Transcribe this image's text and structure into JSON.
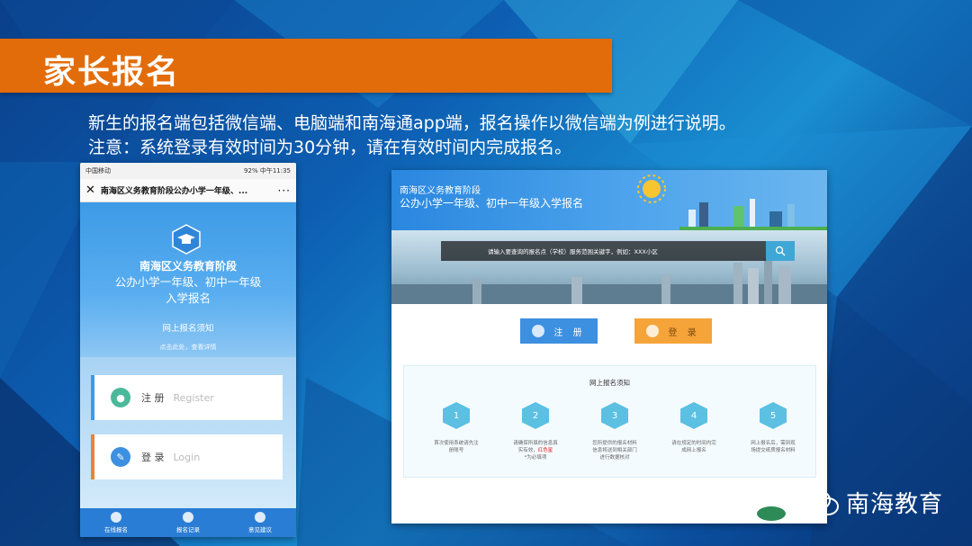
{
  "slide": {
    "title": "家长报名",
    "intro_line1": "新生的报名端包括微信端、电脑端和南海通app端，报名操作以微信端为例进行说明。",
    "intro_line2": "注意：系统登录有效时间为30分钟，请在有效时间内完成报名。",
    "watermark": "南海教育",
    "colors": {
      "banner": "#e36c0a",
      "background": "#0d5fb3"
    }
  },
  "phone": {
    "status_left": "中国移动",
    "status_right": "92% 中午11:35",
    "nav_title": "南海区义务教育阶段公办小学一年级、...",
    "nav_close": "✕",
    "nav_more": "···",
    "hero_line1": "南海区义务教育阶段",
    "hero_line2": "公办小学一年级、初中一年级",
    "hero_line3": "入学报名",
    "notice_link": "网上报名须知",
    "notice_sub": "点击此处，查看详情",
    "register_cn": "注 册",
    "register_en": "Register",
    "login_cn": "登 录",
    "login_en": "Login",
    "tabs": [
      "在线报名",
      "报名记录",
      "意见建议"
    ]
  },
  "web": {
    "header_line1": "南海区义务教育阶段",
    "header_line2": "公办小学一年级、初中一年级入学报名",
    "search_placeholder": "请输入要查询的报名点（学校）服务范围关键字，例如：XXX小区",
    "register_button": "注 册",
    "login_button": "登 录",
    "notice_title": "网上报名须知",
    "steps": [
      {
        "num": "1",
        "text_a": "首次使用系统请先注",
        "text_b": "册账号",
        "text_red": "",
        "text_c": ""
      },
      {
        "num": "2",
        "text_a": "请确保所填的信息真",
        "text_b": "实有效，",
        "text_red": "红色星",
        "text_c": "*为必填项"
      },
      {
        "num": "3",
        "text_a": "您所提供的报名材料",
        "text_b": "信息将送到相关部门",
        "text_red": "",
        "text_c": "进行数据核对"
      },
      {
        "num": "4",
        "text_a": "请在规定的时间内完",
        "text_b": "成网上报名",
        "text_red": "",
        "text_c": ""
      },
      {
        "num": "5",
        "text_a": "网上报名后，需到现",
        "text_b": "场提交纸质报名材料",
        "text_red": "",
        "text_c": ""
      }
    ]
  }
}
